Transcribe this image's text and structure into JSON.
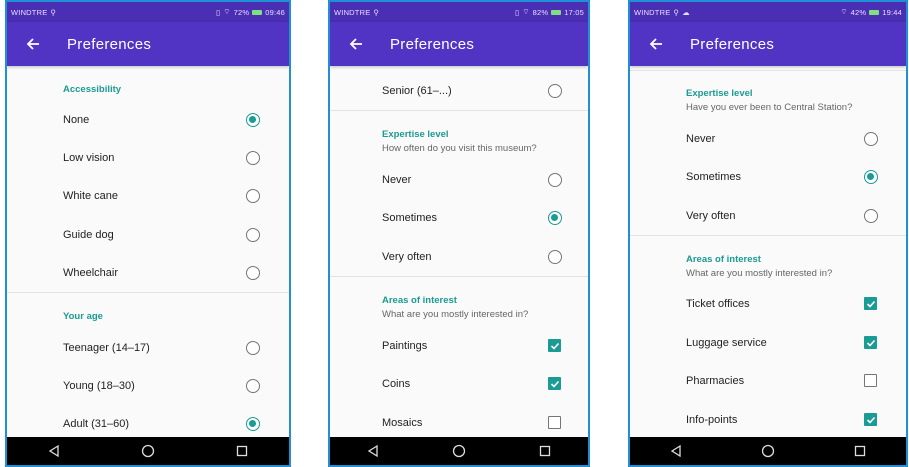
{
  "screens": [
    {
      "status": {
        "carrier": "WINDTRE",
        "battery": "72%",
        "time": "09:46"
      },
      "title": "Preferences",
      "section1": {
        "header": "Accessibility"
      },
      "rows1": [
        "None",
        "Low vision",
        "White cane",
        "Guide dog",
        "Wheelchair"
      ],
      "section2": {
        "header": "Your age"
      },
      "rows2": [
        "Teenager (14–17)",
        "Young (18–30)",
        "Adult (31–60)"
      ]
    },
    {
      "status": {
        "carrier": "WINDTRE",
        "battery": "82%",
        "time": "17:05"
      },
      "title": "Preferences",
      "top_row": "Senior (61–...)",
      "section1": {
        "header": "Expertise level",
        "sub": "How often do you visit this museum?"
      },
      "rows1": [
        "Never",
        "Sometimes",
        "Very often"
      ],
      "section2": {
        "header": "Areas of interest",
        "sub": "What are you mostly interested in?"
      },
      "rows2": [
        "Paintings",
        "Coins",
        "Mosaics"
      ]
    },
    {
      "status": {
        "carrier": "WINDTRE",
        "battery": "42%",
        "time": "19:44"
      },
      "title": "Preferences",
      "section1": {
        "header": "Expertise level",
        "sub": "Have you ever been to Central Station?"
      },
      "rows1": [
        "Never",
        "Sometimes",
        "Very often"
      ],
      "section2": {
        "header": "Areas of interest",
        "sub": "What are you mostly interested in?"
      },
      "rows2": [
        "Ticket offices",
        "Luggage service",
        "Pharmacies",
        "Info-points"
      ]
    }
  ],
  "colors": {
    "appbar": "#5134c4",
    "accent": "#1a9b93",
    "frame": "#1f8fd6"
  },
  "icons": {
    "back": "arrow-back-icon",
    "nav": [
      "nav-back-icon",
      "nav-home-icon",
      "nav-recents-icon"
    ]
  }
}
